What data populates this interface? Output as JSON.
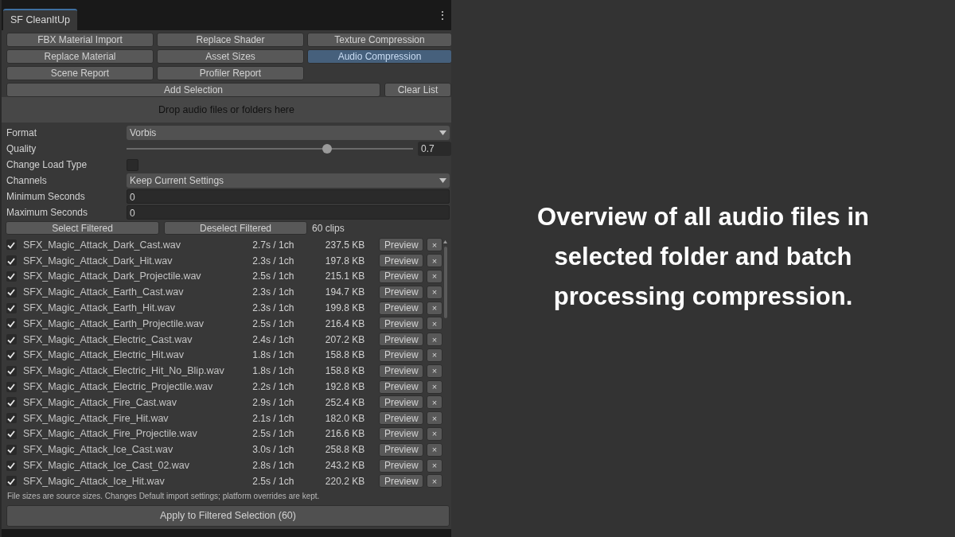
{
  "window": {
    "tabs": [
      {
        "label": "SF CleanItUp",
        "selected": true
      }
    ],
    "menu_icon": "⋮"
  },
  "modules": [
    {
      "label": "FBX Material Import",
      "selected": false
    },
    {
      "label": "Replace Shader",
      "selected": false
    },
    {
      "label": "Texture Compression",
      "selected": false
    },
    {
      "label": "Replace Material",
      "selected": false
    },
    {
      "label": "Asset Sizes",
      "selected": false
    },
    {
      "label": "Audio Compression",
      "selected": true
    },
    {
      "label": "Scene Report",
      "selected": false
    },
    {
      "label": "Profiler Report",
      "selected": false
    }
  ],
  "add_selection": "Add Selection",
  "clear_list": "Clear List",
  "drop_zone": "Drop audio files or folders here",
  "settings": [
    {
      "kind": "dropdown",
      "label": "Format",
      "value": "Vorbis"
    },
    {
      "kind": "slider",
      "label": "Quality",
      "level": 0.7,
      "value": "0.7"
    },
    {
      "kind": "checkbox",
      "label": "Change Load Type",
      "checked": false
    },
    {
      "kind": "dropdown",
      "label": "Channels",
      "value": "Keep Current Settings"
    },
    {
      "kind": "field",
      "label": "Minimum Seconds",
      "value": "0"
    },
    {
      "kind": "field",
      "label": "Maximum Seconds",
      "value": "0"
    }
  ],
  "select_filtered": "Select Filtered",
  "deselect_filtered": "Deselect Filtered",
  "clip_count": "60 clips",
  "clips": [
    {
      "checked": true,
      "name": "SFX_Magic_Attack_Dark_Cast.wav",
      "duration": "2.7s / 1ch",
      "size": "237.5 KB",
      "preview": "Preview",
      "remove": "×"
    },
    {
      "checked": true,
      "name": "SFX_Magic_Attack_Dark_Hit.wav",
      "duration": "2.3s / 1ch",
      "size": "197.8 KB",
      "preview": "Preview",
      "remove": "×"
    },
    {
      "checked": true,
      "name": "SFX_Magic_Attack_Dark_Projectile.wav",
      "duration": "2.5s / 1ch",
      "size": "215.1 KB",
      "preview": "Preview",
      "remove": "×"
    },
    {
      "checked": true,
      "name": "SFX_Magic_Attack_Earth_Cast.wav",
      "duration": "2.3s / 1ch",
      "size": "194.7 KB",
      "preview": "Preview",
      "remove": "×"
    },
    {
      "checked": true,
      "name": "SFX_Magic_Attack_Earth_Hit.wav",
      "duration": "2.3s / 1ch",
      "size": "199.8 KB",
      "preview": "Preview",
      "remove": "×"
    },
    {
      "checked": true,
      "name": "SFX_Magic_Attack_Earth_Projectile.wav",
      "duration": "2.5s / 1ch",
      "size": "216.4 KB",
      "preview": "Preview",
      "remove": "×"
    },
    {
      "checked": true,
      "name": "SFX_Magic_Attack_Electric_Cast.wav",
      "duration": "2.4s / 1ch",
      "size": "207.2 KB",
      "preview": "Preview",
      "remove": "×"
    },
    {
      "checked": true,
      "name": "SFX_Magic_Attack_Electric_Hit.wav",
      "duration": "1.8s / 1ch",
      "size": "158.8 KB",
      "preview": "Preview",
      "remove": "×"
    },
    {
      "checked": true,
      "name": "SFX_Magic_Attack_Electric_Hit_No_Blip.wav",
      "duration": "1.8s / 1ch",
      "size": "158.8 KB",
      "preview": "Preview",
      "remove": "×"
    },
    {
      "checked": true,
      "name": "SFX_Magic_Attack_Electric_Projectile.wav",
      "duration": "2.2s / 1ch",
      "size": "192.8 KB",
      "preview": "Preview",
      "remove": "×"
    },
    {
      "checked": true,
      "name": "SFX_Magic_Attack_Fire_Cast.wav",
      "duration": "2.9s / 1ch",
      "size": "252.4 KB",
      "preview": "Preview",
      "remove": "×"
    },
    {
      "checked": true,
      "name": "SFX_Magic_Attack_Fire_Hit.wav",
      "duration": "2.1s / 1ch",
      "size": "182.0 KB",
      "preview": "Preview",
      "remove": "×"
    },
    {
      "checked": true,
      "name": "SFX_Magic_Attack_Fire_Projectile.wav",
      "duration": "2.5s / 1ch",
      "size": "216.6 KB",
      "preview": "Preview",
      "remove": "×"
    },
    {
      "checked": true,
      "name": "SFX_Magic_Attack_Ice_Cast.wav",
      "duration": "3.0s / 1ch",
      "size": "258.8 KB",
      "preview": "Preview",
      "remove": "×"
    },
    {
      "checked": true,
      "name": "SFX_Magic_Attack_Ice_Cast_02.wav",
      "duration": "2.8s / 1ch",
      "size": "243.2 KB",
      "preview": "Preview",
      "remove": "×"
    },
    {
      "checked": true,
      "name": "SFX_Magic_Attack_Ice_Hit.wav",
      "duration": "2.5s / 1ch",
      "size": "220.2 KB",
      "preview": "Preview",
      "remove": "×"
    }
  ],
  "note": "File sizes are source sizes. Changes Default import settings; platform overrides are kept.",
  "apply": "Apply to Filtered Selection (60)",
  "caption": "Overview of all audio files in selected folder and batch processing compression."
}
